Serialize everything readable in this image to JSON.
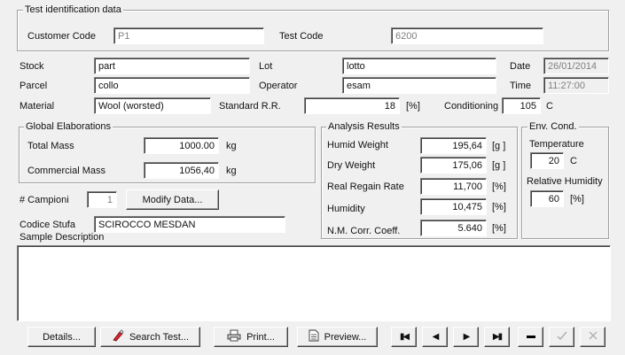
{
  "test_identification": {
    "title": "Test identification data",
    "customer_code_label": "Customer Code",
    "customer_code_value": "P1",
    "test_code_label": "Test Code",
    "test_code_value": "6200"
  },
  "header_fields": {
    "stock_label": "Stock",
    "stock_value": "part",
    "lot_label": "Lot",
    "lot_value": "lotto",
    "date_label": "Date",
    "date_value": "26/01/2014",
    "parcel_label": "Parcel",
    "parcel_value": "collo",
    "operator_label": "Operator",
    "operator_value": "esam",
    "time_label": "Time",
    "time_value": "11:27:00",
    "material_label": "Material",
    "material_value": "Wool (worsted)",
    "standard_rr_label": "Standard R.R.",
    "standard_rr_value": "18",
    "standard_rr_unit": "[%]",
    "conditioning_label": "Conditioning",
    "conditioning_value": "105",
    "conditioning_unit": "C"
  },
  "global_elaborations": {
    "title": "Global Elaborations",
    "total_mass_label": "Total Mass",
    "total_mass_value": "1000.00",
    "total_mass_unit": "kg",
    "commercial_mass_label": "Commercial Mass",
    "commercial_mass_value": "1056,40",
    "commercial_mass_unit": "kg"
  },
  "samples": {
    "campioni_label": "# Campioni",
    "campioni_value": "1",
    "modify_data_label": "Modify Data...",
    "codice_stufa_label": "Codice Stufa",
    "codice_stufa_value": "SCIROCCO MESDAN",
    "sample_description_label": "Sample Description"
  },
  "analysis_results": {
    "title": "Analysis Results",
    "rows": [
      {
        "label": "Humid Weight",
        "value": "195,64",
        "unit": "[g ]"
      },
      {
        "label": "Dry Weight",
        "value": "175,06",
        "unit": "[g ]"
      },
      {
        "label": "Real Regain Rate",
        "value": "11,700",
        "unit": "[%]"
      },
      {
        "label": "Humidity",
        "value": "10,475",
        "unit": "[%]"
      },
      {
        "label": "N.M. Corr. Coeff.",
        "value": "5.640",
        "unit": "[%]"
      }
    ]
  },
  "env_cond": {
    "title": "Env. Cond.",
    "temperature_label": "Temperature",
    "temperature_value": "20",
    "temperature_unit": "C",
    "humidity_label": "Relative Humidity",
    "humidity_value": "60",
    "humidity_unit": "[%]"
  },
  "toolbar": {
    "details_label": "Details...",
    "search_test_label": "Search Test...",
    "print_label": "Print...",
    "preview_label": "Preview..."
  }
}
